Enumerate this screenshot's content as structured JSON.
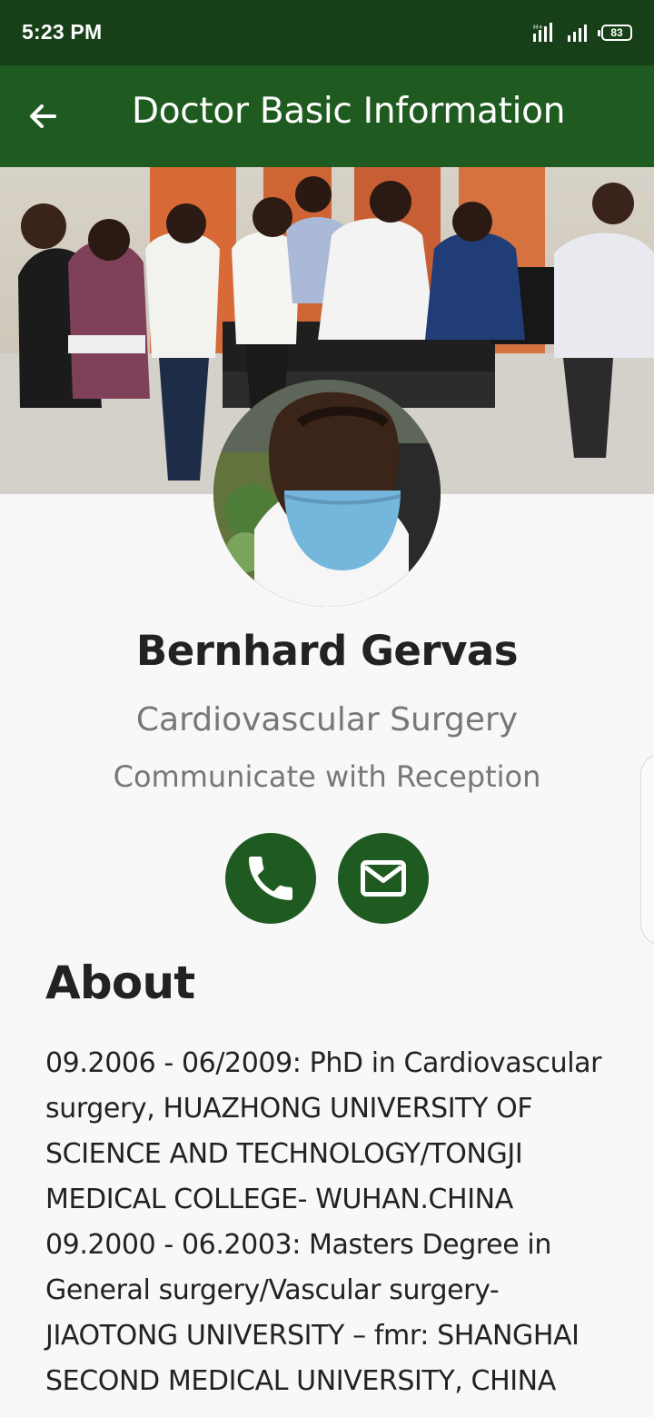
{
  "status_bar": {
    "time": "5:23 PM",
    "battery": "83",
    "icons": [
      "signal-icon",
      "signal-icon",
      "battery-icon"
    ]
  },
  "header": {
    "title": "Doctor Basic Information",
    "back_icon": "arrow-back-icon"
  },
  "profile": {
    "name": "Bernhard Gervas",
    "specialty": "Cardiovascular Surgery",
    "reception_note": "Communicate with Reception"
  },
  "actions": {
    "call_icon": "phone-icon",
    "email_icon": "mail-icon"
  },
  "about": {
    "heading": "About",
    "text": "09.2006 - 06/2009: PhD in Cardiovascular surgery, HUAZHONG UNIVERSITY OF SCIENCE AND TECHNOLOGY/TONGJI MEDICAL COLLEGE- WUHAN.CHINA 09.2000 - 06.2003: Masters Degree in General surgery/Vascular surgery-JIAOTONG UNIVERSITY – fmr: SHANGHAI SECOND MEDICAL UNIVERSITY, CHINA"
  },
  "colors": {
    "status_bar": "#174018",
    "app_bar": "#1f5b20",
    "action_button": "#1f5b20",
    "background": "#f8f8f8"
  }
}
